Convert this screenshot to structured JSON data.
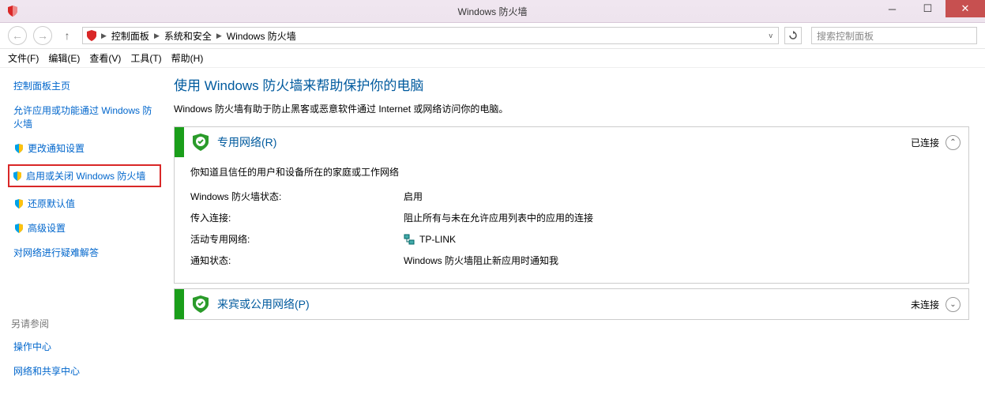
{
  "window": {
    "title": "Windows 防火墙"
  },
  "breadcrumb": {
    "items": [
      "控制面板",
      "系统和安全",
      "Windows 防火墙"
    ]
  },
  "search": {
    "placeholder": "搜索控制面板"
  },
  "menu": {
    "file": "文件(F)",
    "edit": "编辑(E)",
    "view": "查看(V)",
    "tools": "工具(T)",
    "help": "帮助(H)"
  },
  "sidebar": {
    "home": "控制面板主页",
    "allow_app": "允许应用或功能通过 Windows 防火墙",
    "notify": "更改通知设置",
    "toggle": "启用或关闭 Windows 防火墙",
    "restore": "还原默认值",
    "advanced": "高级设置",
    "troubleshoot": "对网络进行疑难解答",
    "see_also": "另请参阅",
    "action_center": "操作中心",
    "net_share": "网络和共享中心"
  },
  "main": {
    "heading": "使用 Windows 防火墙来帮助保护你的电脑",
    "desc": "Windows 防火墙有助于防止黑客或恶意软件通过 Internet 或网络访问你的电脑。",
    "private": {
      "title": "专用网络(R)",
      "status": "已连接",
      "sub": "你知道且信任的用户和设备所在的家庭或工作网络",
      "rows": {
        "state_k": "Windows 防火墙状态:",
        "state_v": "启用",
        "incoming_k": "传入连接:",
        "incoming_v": "阻止所有与未在允许应用列表中的应用的连接",
        "active_k": "活动专用网络:",
        "active_v": "TP-LINK",
        "notify_k": "通知状态:",
        "notify_v": "Windows 防火墙阻止新应用时通知我"
      }
    },
    "public": {
      "title": "来宾或公用网络(P)",
      "status": "未连接"
    }
  }
}
